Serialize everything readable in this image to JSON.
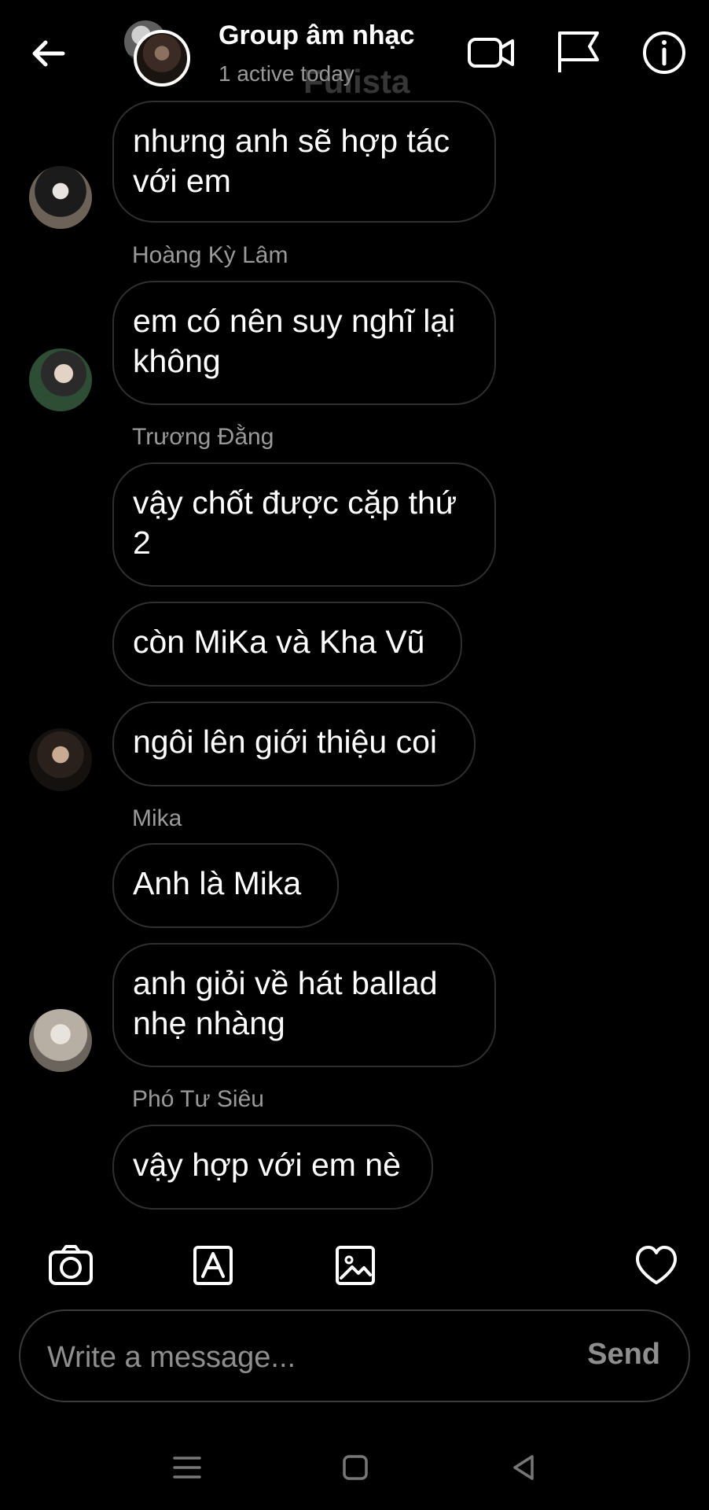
{
  "header": {
    "title": "Group âm nhạc",
    "status": "1 active today",
    "watermark": "Fulista"
  },
  "messages": [
    {
      "text": "nhưng anh sẽ hợp tác với em"
    },
    {
      "sender": "Hoàng Kỳ Lâm",
      "text": "em có nên suy nghĩ lại không"
    },
    {
      "sender": "Trương Đằng",
      "text": "vậy chốt được cặp thứ 2"
    },
    {
      "text": "còn MiKa và Kha Vũ"
    },
    {
      "text": "ngôi lên giới thiệu coi"
    },
    {
      "sender": "Mika",
      "text": "Anh là Mika"
    },
    {
      "text": "anh giỏi về hát ballad nhẹ nhàng"
    },
    {
      "sender": "Phó Tư Siêu",
      "text": "vậy hợp với em nè"
    }
  ],
  "composer": {
    "placeholder": "Write a message...",
    "send_label": "Send"
  },
  "icons": {
    "header": [
      "back-arrow-icon",
      "video-call-icon",
      "flag-icon",
      "info-icon"
    ],
    "toolbar": [
      "camera-icon",
      "sticker-icon",
      "gallery-icon",
      "heart-icon"
    ],
    "nav": [
      "menu-icon",
      "home-icon",
      "back-icon"
    ]
  },
  "colors": {
    "background": "#000000",
    "text": "#ffffff",
    "muted": "#9a9a9a",
    "bubble_border": "#2f2f2f"
  }
}
